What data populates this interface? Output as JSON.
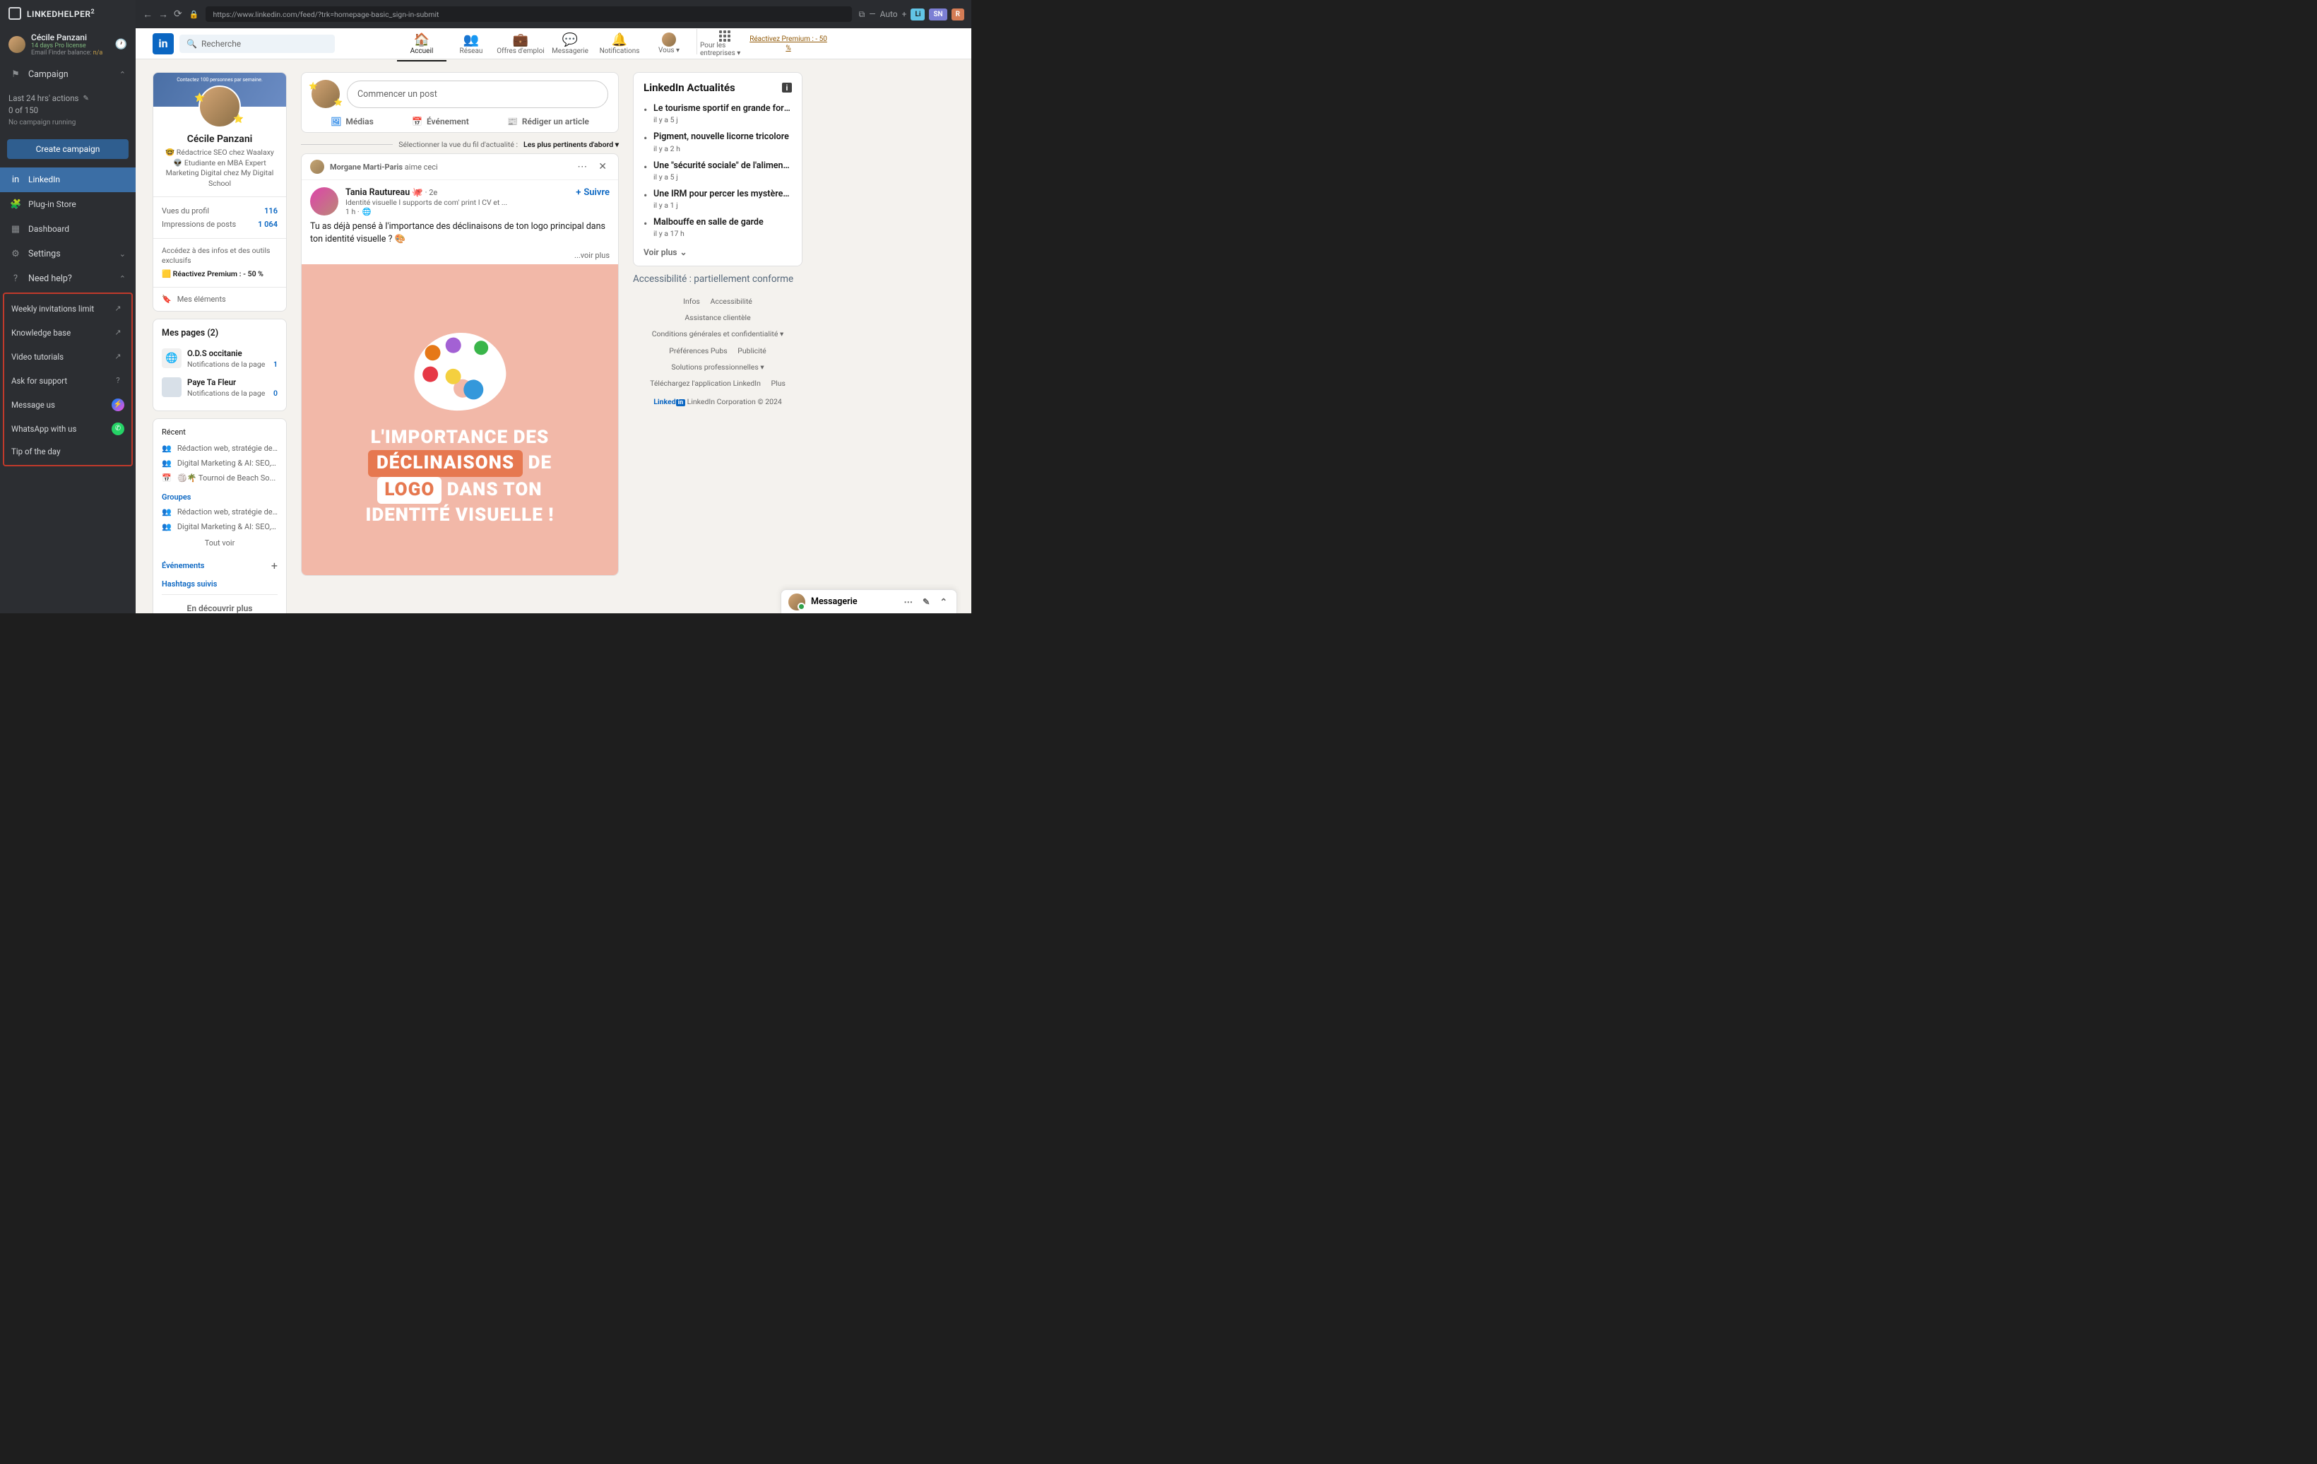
{
  "sidebar": {
    "brand": "LINKEDHELPER",
    "brand_sup": "2",
    "profile": {
      "name": "Cécile Panzani",
      "license": "14 days Pro license",
      "email_finder_label": "Email Finder balance: ",
      "email_finder_value": "n/a"
    },
    "campaign_label": "Campaign",
    "stats": {
      "line1": "Last 24 hrs' actions",
      "line2": "0 of 150",
      "line3": "No campaign running"
    },
    "create_btn": "Create campaign",
    "nav": {
      "linkedin": "LinkedIn",
      "plugin": "Plug-in Store",
      "dashboard": "Dashboard",
      "settings": "Settings",
      "need_help": "Need help?"
    },
    "help": {
      "weekly": "Weekly invitations limit",
      "kb": "Knowledge base",
      "video": "Video tutorials",
      "ask": "Ask for support",
      "message": "Message us",
      "whatsapp": "WhatsApp with us",
      "tip": "Tip of the day"
    }
  },
  "browser": {
    "url": "https://www.linkedin.com/feed/?trk=homepage-basic_sign-in-submit",
    "auto": "Auto",
    "chips": {
      "li": "Li",
      "sn": "SN",
      "r": "R"
    }
  },
  "linkedin": {
    "search_placeholder": "Recherche",
    "nav": {
      "home": "Accueil",
      "network": "Réseau",
      "jobs": "Offres d'emploi",
      "messaging": "Messagerie",
      "notifications": "Notifications",
      "you": "Vous",
      "business": "Pour les entreprises",
      "premium": "Réactivez Premium : - 50 %"
    },
    "profile": {
      "banner_text": "Contactez 100 personnes par semaine.",
      "name": "Cécile Panzani",
      "desc": "🤓 Rédactrice SEO chez Waalaxy 👽 Etudiante en MBA Expert Marketing Digital chez My Digital School",
      "views_label": "Vues du profil",
      "views_val": "116",
      "impressions_label": "Impressions de posts",
      "impressions_val": "1 064",
      "premium_text": "Accédez à des infos et des outils exclusifs",
      "premium_cta": "🟨 Réactivez Premium : - 50 %",
      "items_label": "Mes éléments"
    },
    "pages": {
      "title": "Mes pages (2)",
      "items": [
        {
          "name": "O.D.S occitanie",
          "sub": "Notifications de la page",
          "count": "1",
          "icon_bg": "#fff"
        },
        {
          "name": "Paye Ta Fleur",
          "sub": "Notifications de la page",
          "count": "0",
          "icon_bg": "#d8e0e8"
        }
      ]
    },
    "recent": {
      "title": "Récent",
      "items": [
        "Rédaction web, stratégie de...",
        "Digital Marketing & AI: SEO, ...",
        "🏐🌴 Tournoi de Beach So..."
      ],
      "groups_label": "Groupes",
      "groups": [
        "Rédaction web, stratégie de...",
        "Digital Marketing & AI: SEO, ..."
      ],
      "see_all": "Tout voir",
      "events_label": "Événements",
      "hashtags_label": "Hashtags suivis",
      "discover": "En découvrir plus"
    },
    "compose": {
      "placeholder": "Commencer un post",
      "media": "Médias",
      "event": "Événement",
      "article": "Rédiger un article"
    },
    "feed_filter": {
      "label": "Sélectionner la vue du fil d'actualité : ",
      "value": "Les plus pertinents d'abord"
    },
    "post": {
      "liker": "Morgane Marti-Paris",
      "liker_action": " aime ceci",
      "author": "Tania Rautureau 🐙",
      "degree": " · 2e",
      "author_title": "Identité visuelle I supports de com' print I CV et ...",
      "time": "1 h ·",
      "body": "Tu as déjà pensé à l'importance des déclinaisons de ton logo principal dans ton identité visuelle ? 🎨",
      "more": "...voir plus",
      "follow": "Suivre",
      "image": {
        "line1": "L'IMPORTANCE DES",
        "word_decl": "DÉCLINAISONS",
        "word_de": "DE",
        "word_logo": "LOGO",
        "word_dans": "DANS TON",
        "line3": "IDENTITÉ VISUELLE !"
      }
    },
    "news": {
      "title": "LinkedIn Actualités",
      "items": [
        {
          "h": "Le tourisme sportif en grande forme",
          "t": "il y a 5 j"
        },
        {
          "h": "Pigment, nouvelle licorne tricolore",
          "t": "il y a 2 h"
        },
        {
          "h": "Une \"sécurité sociale\" de l'aliment...",
          "t": "il y a 5 j"
        },
        {
          "h": "Une IRM pour percer les mystères ...",
          "t": "il y a 1 j"
        },
        {
          "h": "Malbouffe en salle de garde",
          "t": "il y a 17 h"
        }
      ],
      "more": "Voir plus"
    },
    "accessibility": "Accessibilité : partiellement conforme",
    "footer": {
      "infos": "Infos",
      "access": "Accessibilité",
      "assist": "Assistance clientèle",
      "cgu": "Conditions générales et confidentialité",
      "prefs": "Préférences Pubs",
      "pub": "Publicité",
      "solutions": "Solutions professionnelles",
      "download": "Téléchargez l'application LinkedIn",
      "plus": "Plus",
      "brand_pre": "Linked",
      "brand_in": "in",
      "corp": " LinkedIn Corporation © 2024"
    },
    "messaging": "Messagerie"
  }
}
